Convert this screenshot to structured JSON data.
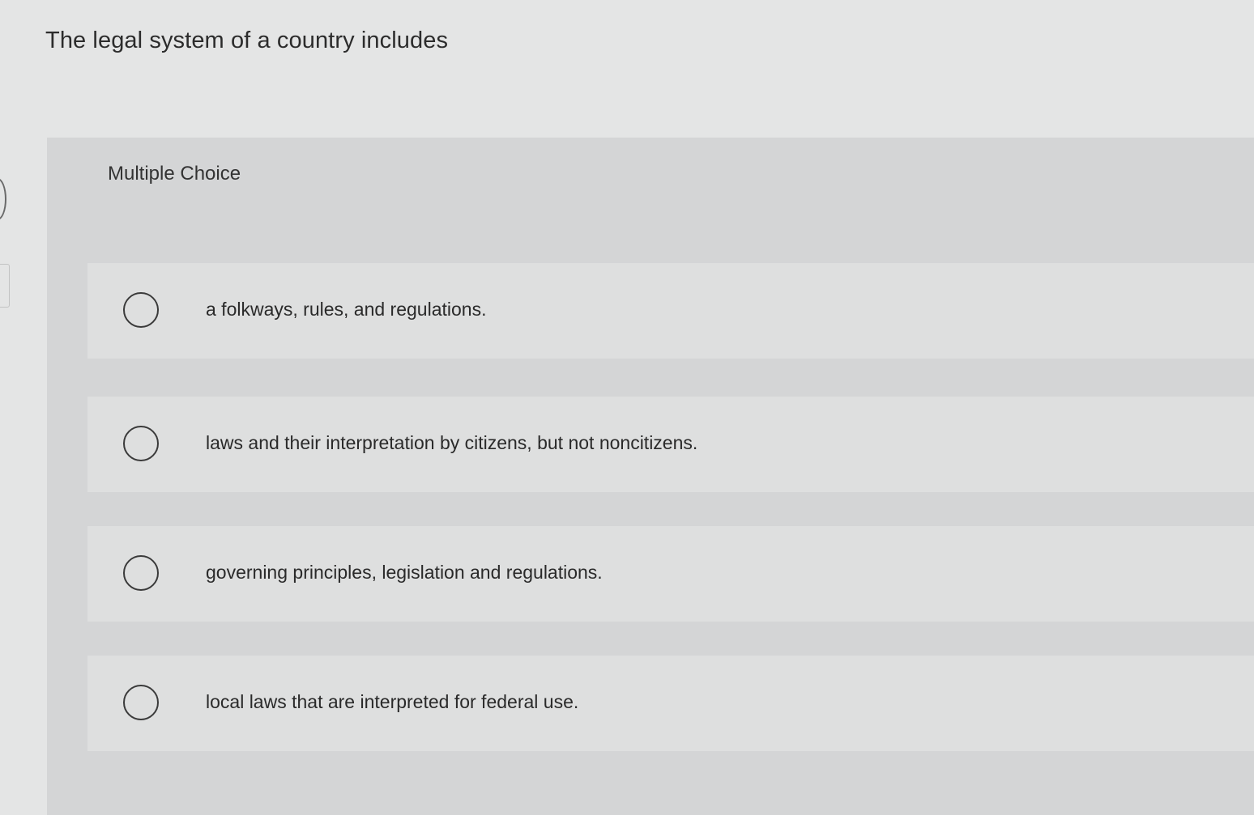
{
  "question": {
    "text": "The legal system of a country includes"
  },
  "quiz": {
    "type_label": "Multiple Choice",
    "options": [
      {
        "label": "a folkways, rules, and regulations."
      },
      {
        "label": "laws and their interpretation by citizens, but not noncitizens."
      },
      {
        "label": "governing principles, legislation and regulations."
      },
      {
        "label": "local laws that are interpreted for federal use."
      }
    ]
  }
}
